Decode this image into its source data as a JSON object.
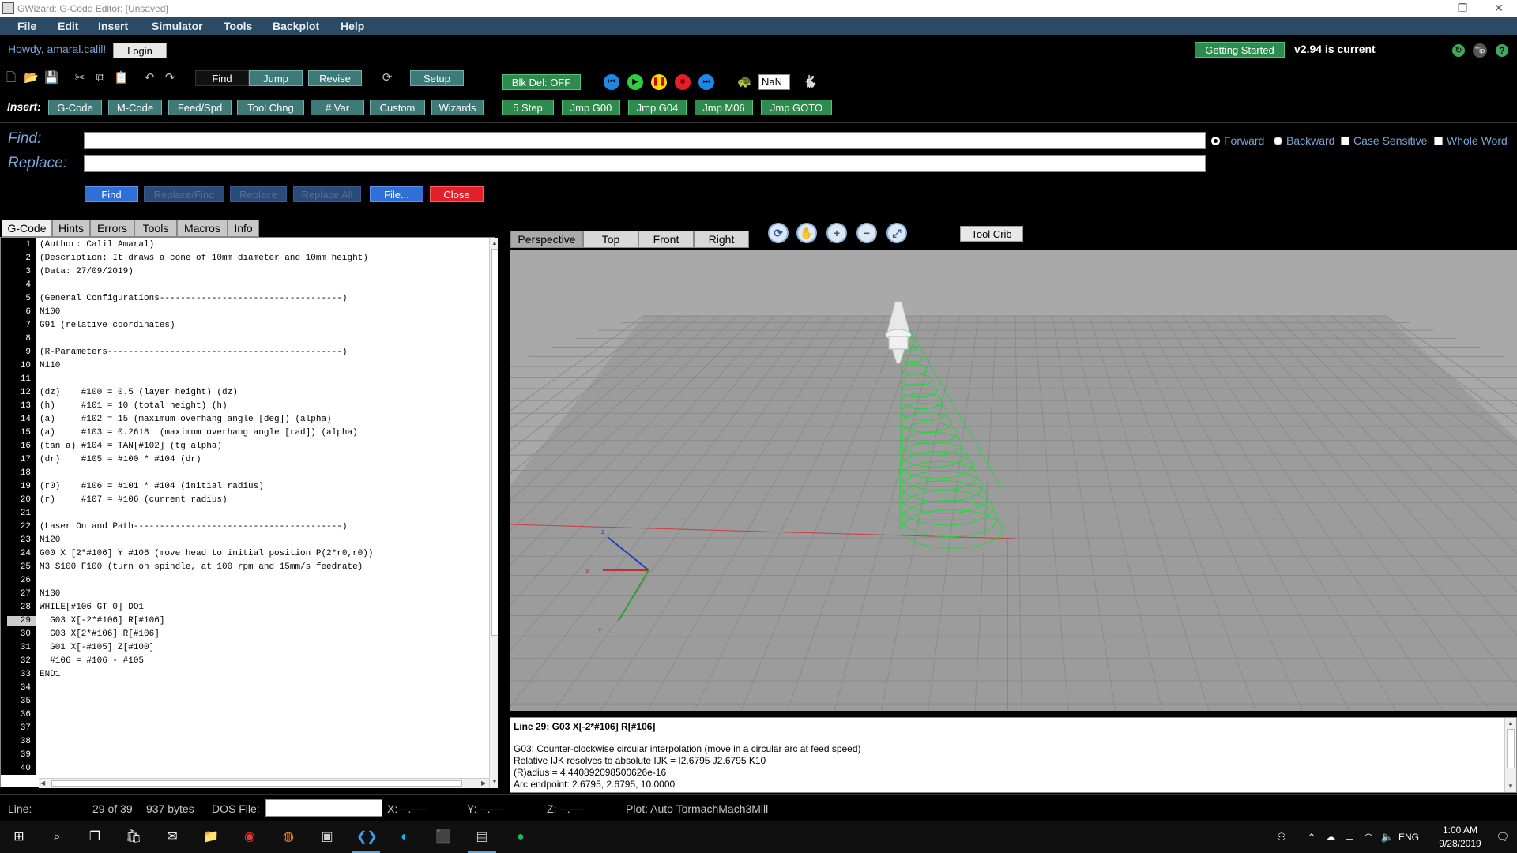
{
  "window": {
    "title": "GWizard: G-Code Editor: [Unsaved]",
    "min": "—",
    "max": "❐",
    "close": "✕"
  },
  "menu": [
    "File",
    "Edit",
    "Insert",
    "Simulator",
    "Tools",
    "Backplot",
    "Help"
  ],
  "header": {
    "greeting": "Howdy, amaral.calil!",
    "login": "Login",
    "getting_started": "Getting Started",
    "version": "v2.94 is current",
    "tip": "Tip",
    "help": "?"
  },
  "toolbar": {
    "find": "Find",
    "jump": "Jump",
    "revise": "Revise",
    "setup": "Setup",
    "blk_del": "Blk Del: OFF",
    "speed_value": "NaN",
    "insert_label": "Insert:",
    "insert_buttons": [
      "G-Code",
      "M-Code",
      "Feed/Spd",
      "Tool Chng",
      "# Var",
      "Custom",
      "Wizards"
    ],
    "step_buttons": [
      "5 Step",
      "Jmp G00",
      "Jmp G04",
      "Jmp M06",
      "Jmp GOTO"
    ]
  },
  "find_panel": {
    "find_label": "Find:",
    "replace_label": "Replace:",
    "find_value": "",
    "replace_value": "",
    "options": {
      "forward": "Forward",
      "backward": "Backward",
      "case": "Case Sensitive",
      "whole": "Whole Word"
    },
    "buttons": {
      "find": "Find",
      "replace_find": "Replace/Find",
      "replace": "Replace",
      "replace_all": "Replace All",
      "file": "File...",
      "close": "Close"
    }
  },
  "left_tabs": [
    "G-Code",
    "Hints",
    "Errors",
    "Tools",
    "Macros",
    "Info"
  ],
  "editor": {
    "current_line": 29,
    "lines": [
      "(Author: Calil Amaral)",
      "(Description: It draws a cone of 10mm diameter and 10mm height)",
      "(Data: 27/09/2019)",
      "",
      "(General Configurations-----------------------------------)",
      "N100",
      "G91 (relative coordinates)",
      "",
      "(R-Parameters---------------------------------------------)",
      "N110",
      "",
      "(dz)    #100 = 0.5 (layer height) (dz)",
      "(h)     #101 = 10 (total height) (h)",
      "(a)     #102 = 15 (maximum overhang angle [deg]) (alpha)",
      "(a)     #103 = 0.2618  (maximum overhang angle [rad]) (alpha)",
      "(tan a) #104 = TAN[#102] (tg alpha)",
      "(dr)    #105 = #100 * #104 (dr)",
      "",
      "(r0)    #106 = #101 * #104 (initial radius)",
      "(r)     #107 = #106 (current radius)",
      "",
      "(Laser On and Path----------------------------------------)",
      "N120",
      "G00 X [2*#106] Y #106 (move head to initial position P(2*r0,r0))",
      "M3 S100 F100 (turn on spindle, at 100 rpm and 15mm/s feedrate)",
      "",
      "N130",
      "WHILE[#106 GT 0] DO1",
      "  G03 X[-2*#106] R[#106]",
      "  G03 X[2*#106] R[#106]",
      "  G01 X[-#105] Z[#100]",
      "  #106 = #106 - #105",
      "END1",
      "",
      "",
      "",
      "",
      "",
      "",
      "",
      ""
    ]
  },
  "view_tabs": [
    "Perspective",
    "Top",
    "Front",
    "Right"
  ],
  "tool_crib": "Tool Crib",
  "axes": {
    "x": "x",
    "y": "y",
    "z": "z"
  },
  "info": {
    "line_title": "Line 29: G03 X[-2*#106] R[#106]",
    "lines": [
      "G03: Counter-clockwise circular interpolation (move in a circular arc at feed speed)",
      "Relative IJK resolves to absolute IJK = I2.6795 J2.6795 K10",
      " (R)adius = 4.440892098500626e-16",
      "Arc endpoint: 2.6795, 2.6795, 10.0000"
    ]
  },
  "status": {
    "line_label": "Line:",
    "line_pos": "29 of 39",
    "bytes": "937 bytes",
    "dos_label": "DOS File:",
    "dos_value": "",
    "x": "X:  --.----",
    "y": "Y:  --.----",
    "z": "Z:  --.----",
    "plot": "Plot: Auto  TormachMach3Mill"
  },
  "taskbar": {
    "lang": "ENG",
    "time": "1:00 AM",
    "date": "9/28/2019"
  },
  "colors": {
    "green": "#2e8b4e",
    "teal": "#3e7a78",
    "menu": "#2b4a63",
    "cone": "#22d63a"
  }
}
